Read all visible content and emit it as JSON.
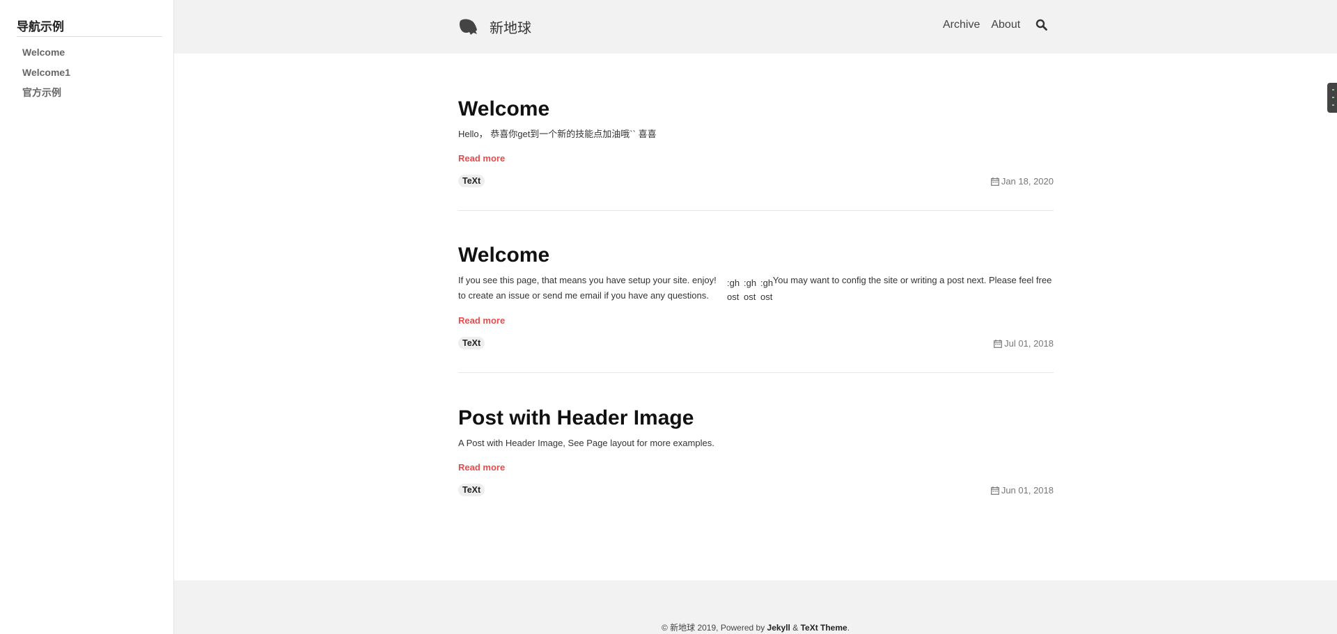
{
  "sidebar": {
    "title": "导航示例",
    "items": [
      {
        "label": "Welcome"
      },
      {
        "label": "Welcome1"
      },
      {
        "label": "官方示例"
      }
    ]
  },
  "header": {
    "site_name": "新地球",
    "logo_icon": "ginkgo-leaf-logo",
    "nav": [
      {
        "label": "Archive"
      },
      {
        "label": "About"
      }
    ],
    "search_icon": "search-icon"
  },
  "posts": [
    {
      "title": "Welcome",
      "excerpt": "Hello， 恭喜你get到一个新的技能点加油哦`` 喜喜",
      "read_more": "Read more",
      "tag": "TeXt",
      "date": "Jan 18, 2020"
    },
    {
      "title": "Welcome",
      "excerpt_part1": "If you see this page, that means you have setup your site. enjoy!",
      "excerpt_part2": "You may want to config the site or writing a post next. Please feel free to create an issue or send me email if you have any questions.",
      "broken_image_alt": ":gh ost:",
      "read_more": "Read more",
      "tag": "TeXt",
      "date": "Jul 01, 2018"
    },
    {
      "title": "Post with Header Image",
      "excerpt": "A Post with Header Image, See Page layout for more examples.",
      "read_more": "Read more",
      "tag": "TeXt",
      "date": "Jun 01, 2018"
    }
  ],
  "footer": {
    "prefix": "© 新地球 2019, Powered by ",
    "jekyll": "Jekyll",
    "amp": " & ",
    "theme": "TeXt Theme",
    "suffix": "."
  },
  "colors": {
    "accent": "#e84a4a",
    "header_bg": "#f2f2f2"
  }
}
